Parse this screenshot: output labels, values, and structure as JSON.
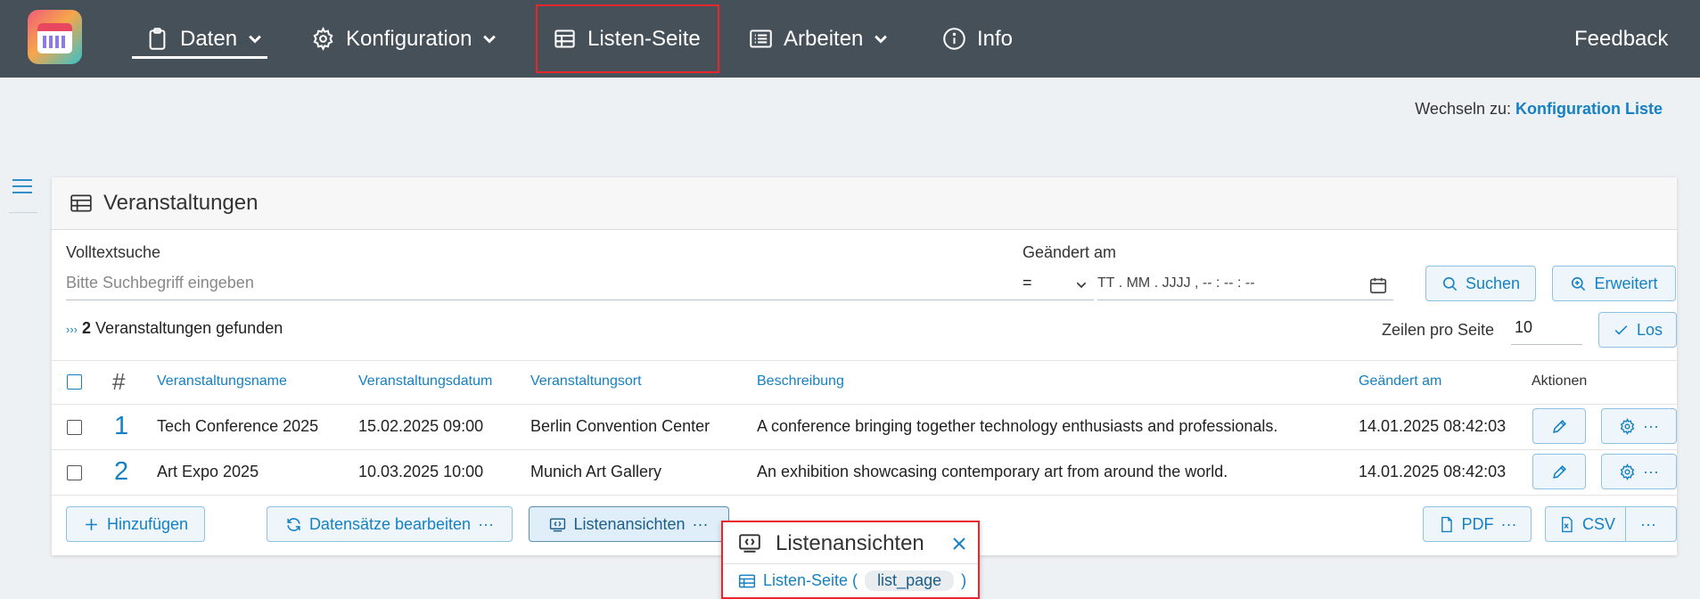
{
  "nav": {
    "items": [
      {
        "label": "Daten",
        "icon": "clipboard-icon"
      },
      {
        "label": "Konfiguration",
        "icon": "gear-icon"
      },
      {
        "label": "Listen-Seite",
        "icon": "table-icon"
      },
      {
        "label": "Arbeiten",
        "icon": "list-icon"
      },
      {
        "label": "Info",
        "icon": "info-icon"
      }
    ],
    "feedback": "Feedback"
  },
  "switch": {
    "prefix": "Wechseln zu:",
    "link": "Konfiguration Liste"
  },
  "card": {
    "title": "Veranstaltungen"
  },
  "search": {
    "fulltext_label": "Volltextsuche",
    "fulltext_placeholder": "Bitte Suchbegriff eingeben",
    "changed_label": "Geändert am",
    "operator": "=",
    "date_placeholder": "TT . MM . JJJJ ,  -- : -- : --",
    "search_button": "Suchen",
    "advanced_button": "Erweitert"
  },
  "results": {
    "count": "2",
    "text": "Veranstaltungen gefunden",
    "rows_label": "Zeilen pro Seite",
    "rows_value": "10",
    "go_button": "Los"
  },
  "table": {
    "headers": [
      "#",
      "Veranstaltungsname",
      "Veranstaltungsdatum",
      "Veranstaltungsort",
      "Beschreibung",
      "Geändert am",
      "Aktionen"
    ],
    "rows": [
      {
        "num": "1",
        "name": "Tech Conference 2025",
        "date": "15.02.2025 09:00",
        "place": "Berlin Convention Center",
        "desc": "A conference bringing together technology enthusiasts and professionals.",
        "changed": "14.01.2025 08:42:03"
      },
      {
        "num": "2",
        "name": "Art Expo 2025",
        "date": "10.03.2025 10:00",
        "place": "Munich Art Gallery",
        "desc": "An exhibition showcasing contemporary art from around the world.",
        "changed": "14.01.2025 08:42:03"
      }
    ]
  },
  "footer": {
    "add": "Hinzufügen",
    "edit_records": "Datensätze bearbeiten",
    "list_views": "Listenansichten",
    "pdf": "PDF",
    "csv": "CSV",
    "more": "···"
  },
  "popup": {
    "title": "Listenansichten",
    "item_label": "Listen-Seite (",
    "item_code": "list_page",
    "item_close": ")"
  },
  "colors": {
    "nav_bg": "#455058",
    "accent": "#1581c4",
    "highlight": "#e8262c"
  }
}
